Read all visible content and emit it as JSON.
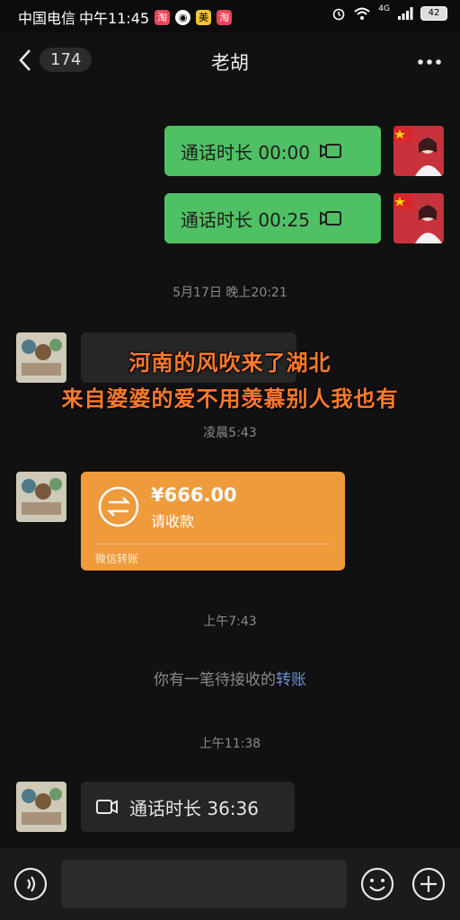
{
  "status_bar": {
    "carrier": "中国电信",
    "time": "中午11:45",
    "app_badge_meituan": "美",
    "network": "4G",
    "battery": "42"
  },
  "header": {
    "back_count": "174",
    "title": "老胡"
  },
  "messages": {
    "call1": "通话时长 00:00",
    "call2": "通话时长 00:25",
    "ts1": "5月17日 晚上20:21",
    "ts2": "凌晨5:43",
    "transfer_amount": "¥666.00",
    "transfer_status": "请收款",
    "transfer_source": "微信转账",
    "ts3": "上午7:43",
    "system_text": "你有一笔待接收的",
    "system_link": "转账",
    "ts4": "上午11:38",
    "call3": "通话时长 36:36"
  },
  "overlay": {
    "line1": "河南的风吹来了湖北",
    "line2": "来自婆婆的爱不用羡慕别人我也有"
  },
  "colors": {
    "green_bubble": "#4fc064",
    "transfer_orange": "#ef9a3b",
    "caption_orange": "#ff7a2c",
    "link_blue": "#6b8fd0"
  }
}
